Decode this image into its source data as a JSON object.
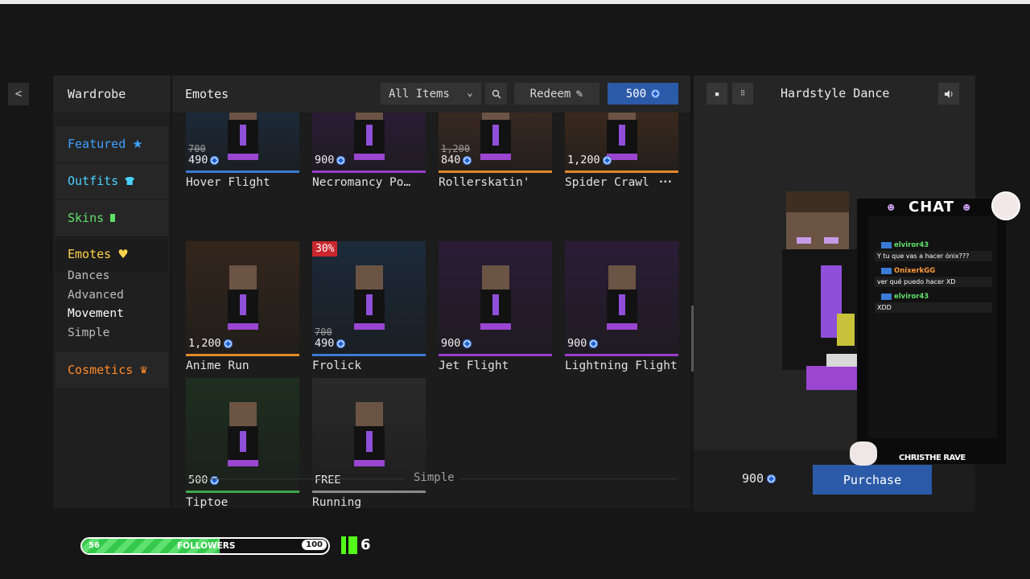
{
  "sidebar": {
    "back_glyph": "<",
    "title": "Wardrobe",
    "items": [
      {
        "label": "Featured",
        "icon": "star-icon",
        "color": "#3ea0ff",
        "glyph": "★"
      },
      {
        "label": "Outfits",
        "icon": "shirt-icon",
        "color": "#4ad1ff",
        "glyph": "👕"
      },
      {
        "label": "Skins",
        "icon": "person-icon",
        "color": "#5fe06a",
        "glyph": "▲"
      },
      {
        "label": "Emotes",
        "icon": "heart-icon",
        "color": "#ffd24a",
        "glyph": "♥"
      },
      {
        "label": "Cosmetics",
        "icon": "crown-icon",
        "color": "#ff8a2b",
        "glyph": "♛"
      }
    ],
    "emote_subitems": [
      "Dances",
      "Advanced",
      "Movement",
      "Simple"
    ],
    "selected_subitem": "Movement"
  },
  "main": {
    "title": "Emotes",
    "filter_label": "All Items",
    "redeem_label": "Redeem",
    "balance": "500",
    "section_label": "Simple"
  },
  "emotes": [
    {
      "name": "Hover Flight",
      "price": "490",
      "old_price": "700",
      "bar_color": "#3a7bd5",
      "bg": "#1c2a3a"
    },
    {
      "name": "Necromancy Po…",
      "price": "900",
      "old_price": "",
      "bar_color": "#9b3ccf",
      "bg": "#2a1c36"
    },
    {
      "name": "Rollerskatin'",
      "price": "840",
      "old_price": "1,200",
      "bar_color": "#e08a2a",
      "bg": "#3a2a22"
    },
    {
      "name": "Spider Crawl",
      "price": "1,200",
      "old_price": "",
      "bar_color": "#e08a2a",
      "bg": "#3b2a1e"
    },
    {
      "name": "Anime Run",
      "price": "1,200",
      "old_price": "",
      "bar_color": "#e08a2a",
      "bg": "#33261c"
    },
    {
      "name": "Frolick",
      "price": "490",
      "old_price": "700",
      "bar_color": "#3a7bd5",
      "bg": "#1c2a3a",
      "sale": "30%"
    },
    {
      "name": "Jet Flight",
      "price": "900",
      "old_price": "",
      "bar_color": "#9b3ccf",
      "bg": "#2a1c36"
    },
    {
      "name": "Lightning Flight",
      "price": "900",
      "old_price": "",
      "bar_color": "#9b3ccf",
      "bg": "#2a1c36"
    },
    {
      "name": "Tiptoe",
      "price": "500",
      "old_price": "",
      "bar_color": "#3fa84a",
      "bg": "#1e2e1f"
    },
    {
      "name": "Running",
      "price": "FREE",
      "old_price": "",
      "bar_color": "#8a8a8a",
      "bg": "#2a2a2a"
    }
  ],
  "preview": {
    "title": "Hardstyle Dance",
    "price": "900",
    "purchase_label": "Purchase"
  },
  "overlay": {
    "chat_title": "CHAT",
    "messages": [
      {
        "user": "elviror43",
        "user_color": "#5fe06a",
        "text": "Y tu que vas a hacer ónix???"
      },
      {
        "user": "OnixerkGG",
        "user_color": "#ff9a3a",
        "text": "ver qué puedo hacer XD"
      },
      {
        "user": "elviror43",
        "user_color": "#5fe06a",
        "text": "XDD"
      }
    ],
    "streamer": "CHRISTHE RAVE",
    "follower_current": "56",
    "follower_label": "FOLLOWERS",
    "follower_goal": "100",
    "follower_progress": 0.56,
    "kick_count": "6"
  }
}
